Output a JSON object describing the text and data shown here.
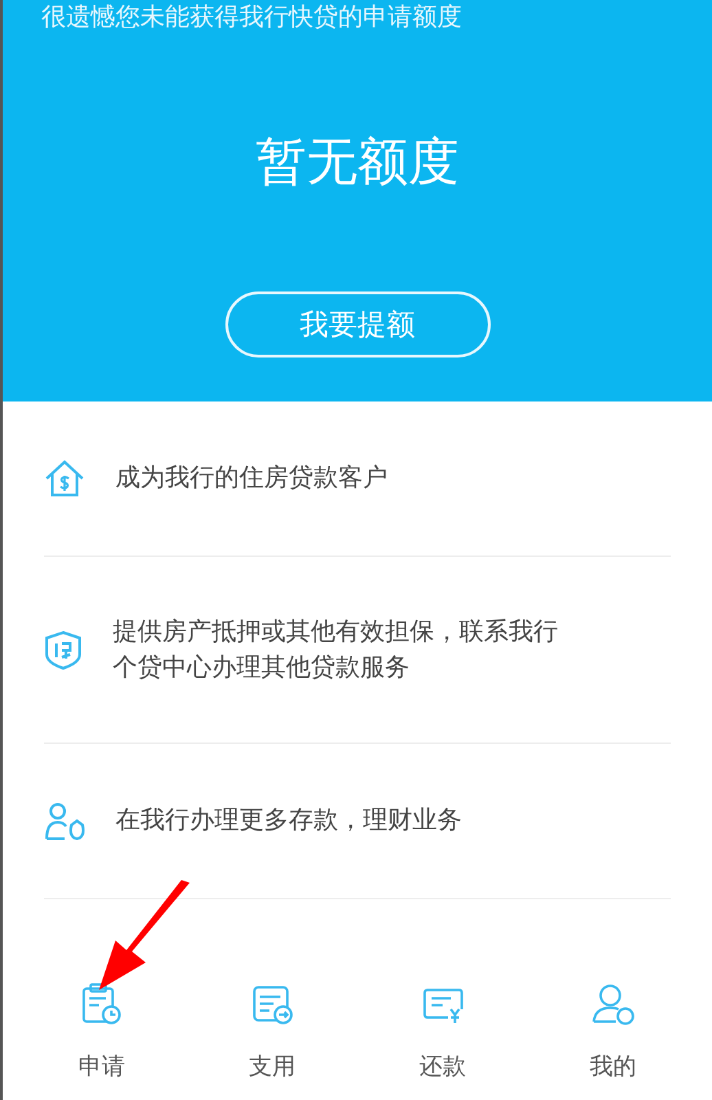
{
  "header": {
    "notice": "很遗憾您未能获得我行快贷的申请额度",
    "title": "暂无额度",
    "button": "我要提额"
  },
  "suggestions": [
    {
      "kind": "house",
      "text": "成为我行的住房贷款客户"
    },
    {
      "kind": "shield",
      "text": "提供房产抵押或其他有效担保，联系我行个贷中心办理其他贷款服务"
    },
    {
      "kind": "person",
      "text": "在我行办理更多存款，理财业务"
    }
  ],
  "tab_bar": [
    {
      "kind": "apply",
      "label": "申请"
    },
    {
      "kind": "use",
      "label": "支用"
    },
    {
      "kind": "repay",
      "label": "还款"
    },
    {
      "kind": "me",
      "label": "我的"
    }
  ]
}
